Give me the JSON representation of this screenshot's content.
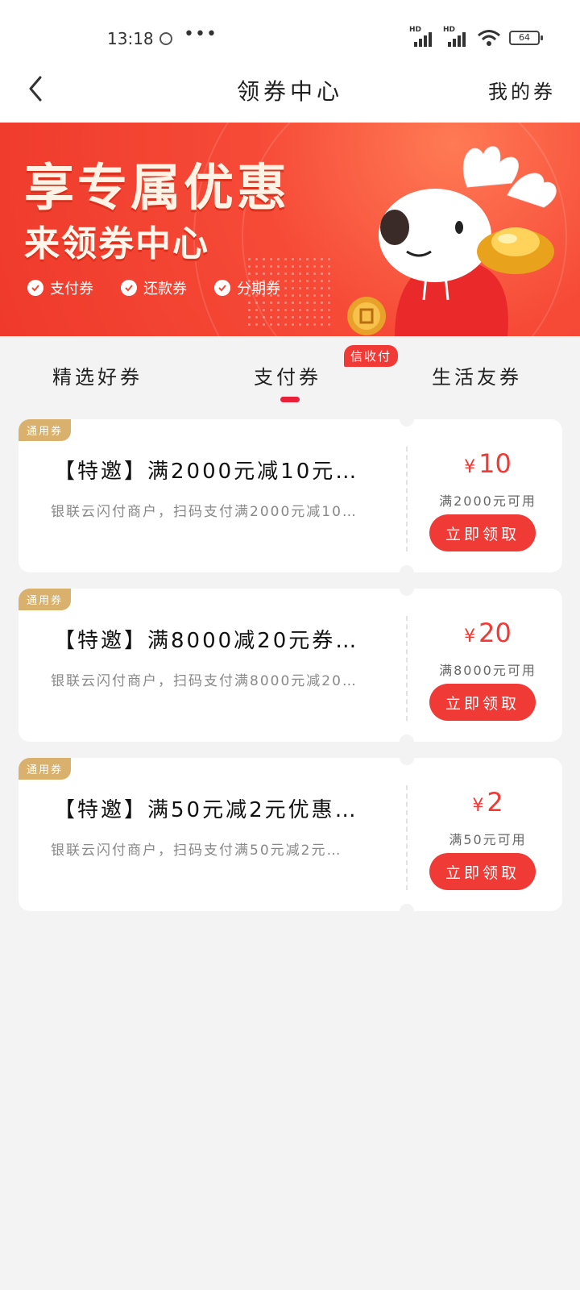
{
  "status_bar": {
    "time": "13:18",
    "battery": "64"
  },
  "nav": {
    "title": "领券中心",
    "right_link": "我的券"
  },
  "banner": {
    "title": "享专属优惠",
    "subtitle": "来领券中心",
    "tags": [
      "支付券",
      "还款券",
      "分期券"
    ]
  },
  "tabs": {
    "items": [
      "精选好券",
      "支付券",
      "生活友券"
    ],
    "active_index": 1,
    "badge": "信收付"
  },
  "coupons": [
    {
      "tag": "通用券",
      "title": "【特邀】满2000元减10元…",
      "desc": "银联云闪付商户，扫码支付满2000元减10…",
      "currency": "¥",
      "amount": "10",
      "condition": "满2000元可用",
      "button": "立即领取"
    },
    {
      "tag": "通用券",
      "title": "【特邀】满8000减20元券…",
      "desc": "银联云闪付商户，扫码支付满8000元减20…",
      "currency": "¥",
      "amount": "20",
      "condition": "满8000元可用",
      "button": "立即领取"
    },
    {
      "tag": "通用券",
      "title": "【特邀】满50元减2元优惠…",
      "desc": "银联云闪付商户，扫码支付满50元减2元…",
      "currency": "¥",
      "amount": "2",
      "condition": "满50元可用",
      "button": "立即领取"
    }
  ],
  "colors": {
    "accent": "#ef3a36",
    "tag_gold": "#d9b06c",
    "background": "#f3f3f3"
  }
}
